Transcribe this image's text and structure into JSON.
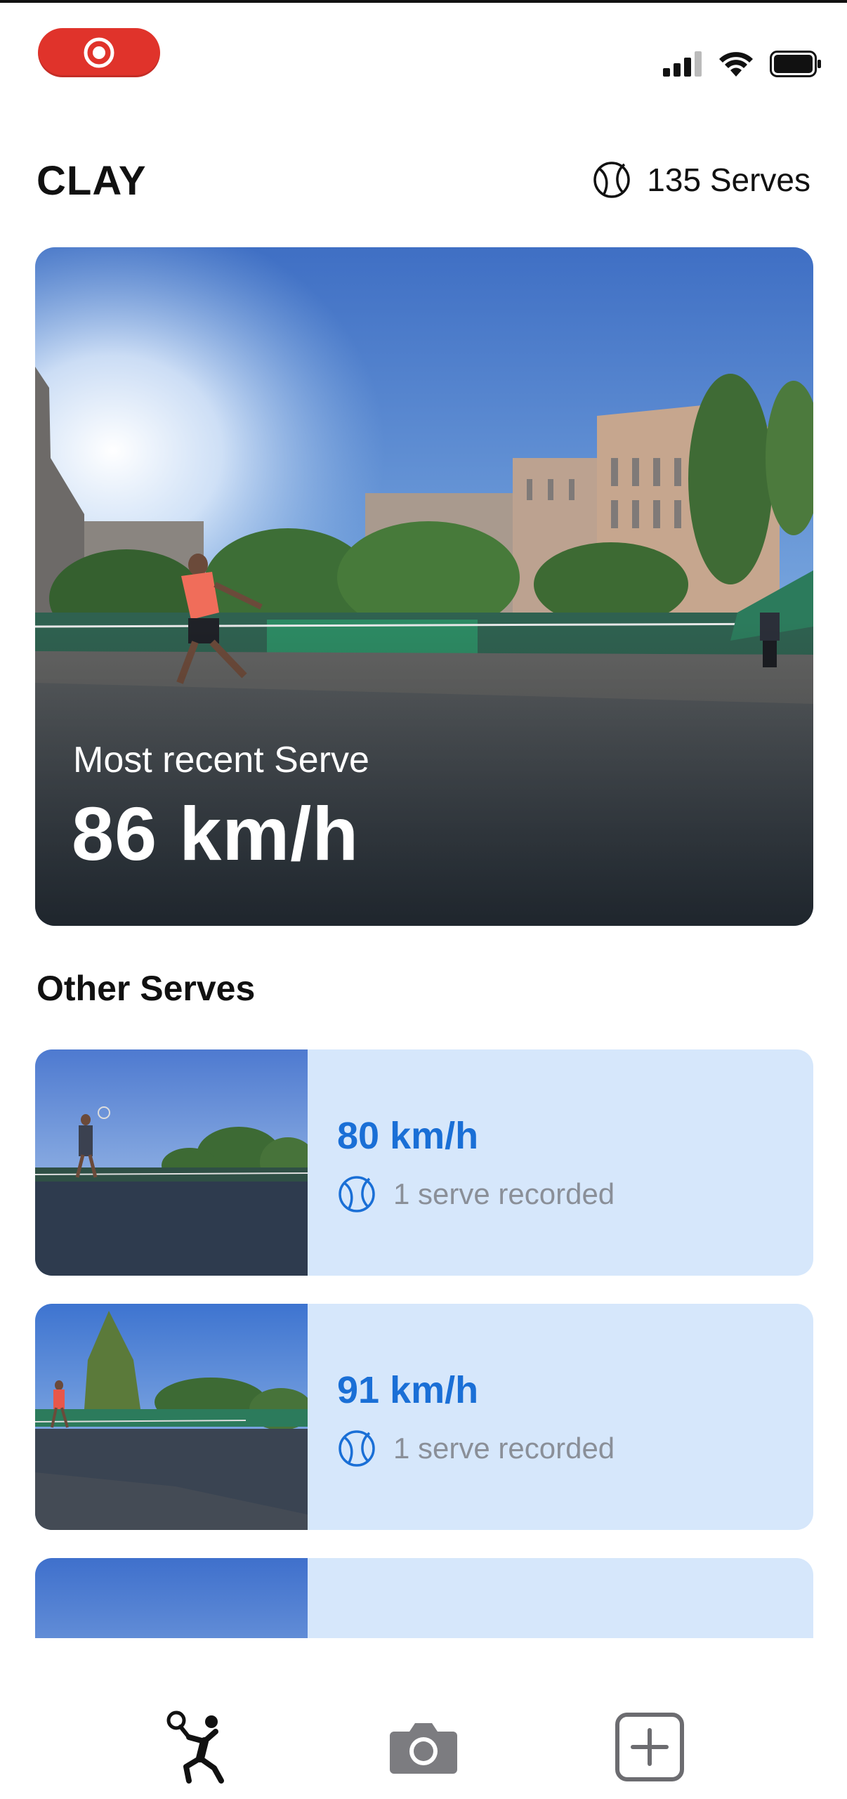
{
  "status_bar": {
    "record_icon": "record-icon",
    "signal_icon": "cellular-signal-icon",
    "wifi_icon": "wifi-icon",
    "battery_icon": "battery-icon"
  },
  "header": {
    "title": "CLAY",
    "serve_count": "135 Serves",
    "serve_icon": "tennis-ball-icon"
  },
  "hero": {
    "label": "Most recent Serve",
    "value": "86 km/h"
  },
  "other_serves": {
    "title": "Other Serves",
    "items": [
      {
        "speed": "80 km/h",
        "recorded": "1 serve recorded"
      },
      {
        "speed": "91 km/h",
        "recorded": "1 serve recorded"
      },
      {
        "speed": "",
        "recorded": ""
      }
    ]
  },
  "tab_bar": {
    "items": [
      {
        "name": "serves",
        "icon": "tennis-player-icon"
      },
      {
        "name": "camera",
        "icon": "camera-icon"
      },
      {
        "name": "add",
        "icon": "plus-square-icon"
      }
    ]
  },
  "colors": {
    "accent": "#1a6fd6",
    "row_bg": "#d6e7fb",
    "record": "#e0332b"
  }
}
